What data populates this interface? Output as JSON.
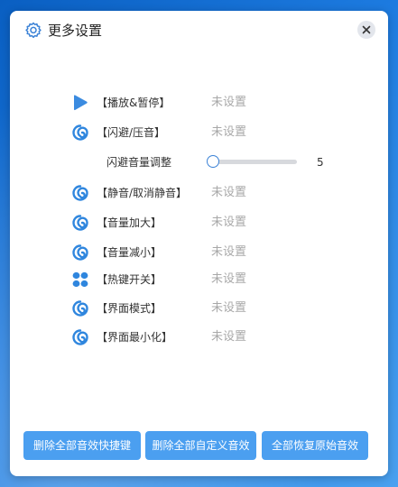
{
  "window": {
    "title": "更多设置"
  },
  "settings": [
    {
      "label": "【播放&暂停】",
      "value": "未设置",
      "icon": "play-icon"
    },
    {
      "label": "【闪避/压音】",
      "value": "未设置",
      "icon": "swirl-icon"
    },
    {
      "label": "【静音/取消静音】",
      "value": "未设置",
      "icon": "swirl-icon"
    },
    {
      "label": "【音量加大】",
      "value": "未设置",
      "icon": "swirl-icon"
    },
    {
      "label": "【音量减小】",
      "value": "未设置",
      "icon": "swirl-icon"
    },
    {
      "label": "【热键开关】",
      "value": "未设置",
      "icon": "four-petal-icon"
    },
    {
      "label": "【界面模式】",
      "value": "未设置",
      "icon": "swirl-icon"
    },
    {
      "label": "【界面最小化】",
      "value": "未设置",
      "icon": "swirl-icon"
    }
  ],
  "duck_volume": {
    "label": "闪避音量调整",
    "value": "5",
    "level": 0
  },
  "buttons": {
    "delete_shortcuts": "删除全部音效快捷键",
    "delete_custom": "删除全部自定义音效",
    "restore_original": "全部恢复原始音效"
  },
  "colors": {
    "accent": "#3b82d6",
    "button": "#4b9ff0",
    "unset_text": "#a8a8a8"
  }
}
